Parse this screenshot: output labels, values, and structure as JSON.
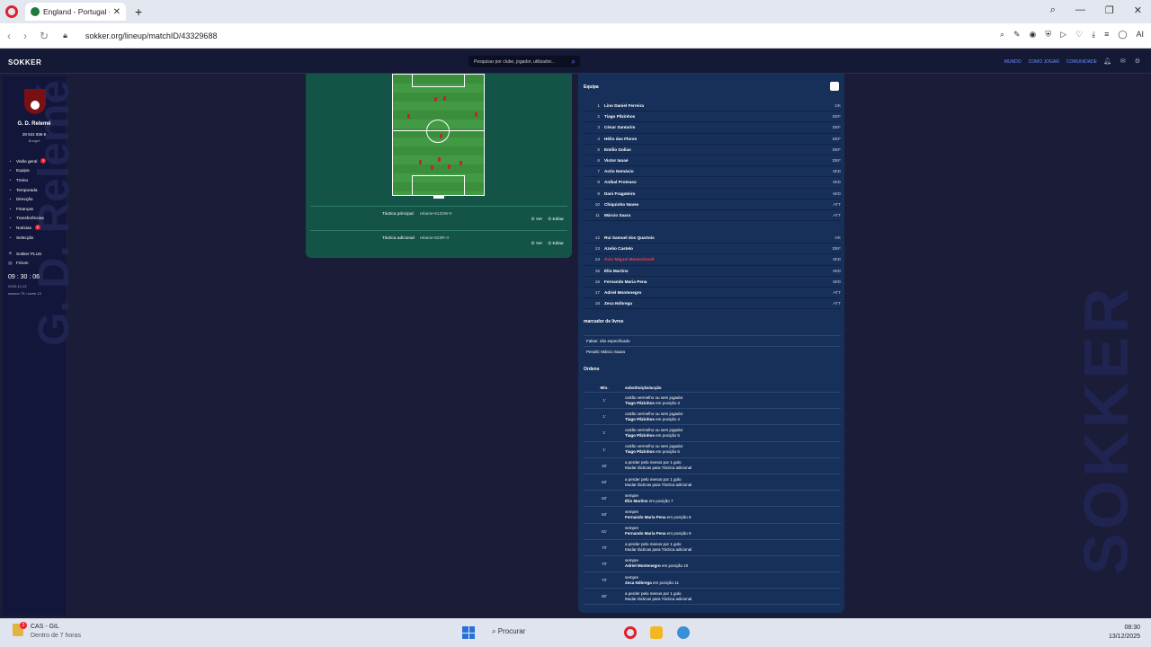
{
  "browser": {
    "tab_title": "England - Portugal - S",
    "url": "sokker.org/lineup/matchID/43329688",
    "ai_label": "AI"
  },
  "site": {
    "logo": "SOKKER",
    "search_placeholder": "Pesquisar por clube, jogador, utilizador...",
    "nav": [
      "MUNDO",
      "COMO JOGAR",
      "COMUNIDADE"
    ]
  },
  "sidebar": {
    "club": "G. D. Relemé",
    "budget_value": "28 531 836 €",
    "budget_label": "Budget",
    "menu": [
      {
        "label": "Visão geral",
        "badge": "5",
        "icon": "gauge-icon"
      },
      {
        "label": "Equipa",
        "badge": "",
        "icon": "team-icon"
      },
      {
        "label": "Treino",
        "badge": "",
        "icon": "training-icon"
      },
      {
        "label": "Temporada",
        "badge": "",
        "icon": "trophy-icon"
      },
      {
        "label": "Direcção",
        "badge": "",
        "icon": "office-icon"
      },
      {
        "label": "Finanças",
        "badge": "",
        "icon": "chart-icon"
      },
      {
        "label": "Transferências",
        "badge": "",
        "icon": "transfer-icon"
      },
      {
        "label": "Notícias",
        "badge": "8",
        "icon": "news-icon"
      },
      {
        "label": "Selecção",
        "badge": "",
        "icon": "flag-icon"
      }
    ],
    "menu2": [
      "Sokker PLUS",
      "Fórum"
    ],
    "clock": "09 : 30 : 06",
    "date": "2025-12-13",
    "season": "season 75 / week 13",
    "bg_text": "G. D. Relemé"
  },
  "tactics": [
    {
      "label": "Táctica principal",
      "value": "relame-5122W-II",
      "view": "Ver",
      "edit": "Editar"
    },
    {
      "label": "Táctica adicional",
      "value": "relame-523R-II",
      "view": "Ver",
      "edit": "Editar"
    }
  ],
  "team": {
    "title": "Equipa",
    "starters": [
      {
        "n": "1",
        "name": "Lino Daniel Ferreira",
        "pos": "GK"
      },
      {
        "n": "2",
        "name": "Tiago Pãzinhos",
        "pos": "DEF"
      },
      {
        "n": "3",
        "name": "César Santarim",
        "pos": "DEF"
      },
      {
        "n": "4",
        "name": "Hélio das Flores",
        "pos": "DEF"
      },
      {
        "n": "5",
        "name": "Emílio Golias",
        "pos": "DEF"
      },
      {
        "n": "6",
        "name": "Victor Ianaé",
        "pos": "DEF"
      },
      {
        "n": "7",
        "name": "Actio Nemácio",
        "pos": "MID"
      },
      {
        "n": "8",
        "name": "Aníbal Proteaso",
        "pos": "MID"
      },
      {
        "n": "9",
        "name": "Dani Fragateiro",
        "pos": "MID"
      },
      {
        "n": "10",
        "name": "Chiquinho Naves",
        "pos": "ATT"
      },
      {
        "n": "11",
        "name": "Márcio Saara",
        "pos": "ATT"
      }
    ],
    "bench": [
      {
        "n": "12",
        "name": "Rui Samuel dos Quartois",
        "pos": "GK",
        "red": false
      },
      {
        "n": "13",
        "name": "Azelio Castelo",
        "pos": "DEF",
        "red": false
      },
      {
        "n": "14",
        "name": "Ávio Miguel Mesentissell",
        "pos": "MID",
        "red": true
      },
      {
        "n": "15",
        "name": "Élio Martins",
        "pos": "MID",
        "red": false
      },
      {
        "n": "16",
        "name": "Fernando Maria Pena",
        "pos": "MID",
        "red": false
      },
      {
        "n": "17",
        "name": "Adriel Montenegro",
        "pos": "ATT",
        "red": false
      },
      {
        "n": "18",
        "name": "Zeca Nóbrega",
        "pos": "ATT",
        "red": false
      }
    ]
  },
  "set_pieces": {
    "title": "marcador de livres",
    "fouls": "Faltas: não especificado",
    "penalty": "Penalti: Márcio Saara"
  },
  "orders": {
    "title": "Ordens",
    "col_min": "Min.",
    "col_sub": "substituição/acção",
    "rows": [
      {
        "min": "1'",
        "l1": "cartão vermelho ou sem jogador",
        "name": "Tiago Pãzinhos",
        "l2": " em posição 3"
      },
      {
        "min": "1'",
        "l1": "cartão vermelho ou sem jogador",
        "name": "Tiago Pãzinhos",
        "l2": " em posição 4"
      },
      {
        "min": "1'",
        "l1": "cartão vermelho ou sem jogador",
        "name": "Tiago Pãzinhos",
        "l2": " em posição 5"
      },
      {
        "min": "1'",
        "l1": "cartão vermelho ou sem jogador",
        "name": "Tiago Pãzinhos",
        "l2": " em posição 6"
      },
      {
        "min": "45'",
        "l1": "a perder pelo menos por 1 golo",
        "name": "",
        "l2": "Mudar tácticas para Táctica adicional"
      },
      {
        "min": "60'",
        "l1": "a perder pelo menos por 1 golo",
        "name": "",
        "l2": "Mudar tácticas para Táctica adicional"
      },
      {
        "min": "60'",
        "l1": "sempre",
        "name": "Élio Martins",
        "l2": " em posição 7"
      },
      {
        "min": "60'",
        "l1": "sempre",
        "name": "Fernando Maria Pena",
        "l2": " em posição 8"
      },
      {
        "min": "61'",
        "l1": "sempre",
        "name": "Fernando Maria Pena",
        "l2": " em posição 9"
      },
      {
        "min": "70'",
        "l1": "a perder pelo menos por 1 golo",
        "name": "",
        "l2": "Mudar tácticas para Táctica adicional"
      },
      {
        "min": "70'",
        "l1": "sempre",
        "name": "Adriel Montenegro",
        "l2": " em posição 10"
      },
      {
        "min": "70'",
        "l1": "sempre",
        "name": "Zeca Nóbrega",
        "l2": " em posição 11"
      },
      {
        "min": "80'",
        "l1": "a perder pelo menos por 1 golo",
        "name": "",
        "l2": "Mudar tácticas para Táctica adicional"
      }
    ]
  },
  "right_bg_text": "SOKKER",
  "taskbar": {
    "weather_badge": "2",
    "weather_title": "CAS - GIL",
    "weather_sub": "Dentro de 7 horas",
    "search": "Procurar",
    "time": "08:30",
    "date": "13/12/2025"
  },
  "colors": {
    "accent": "#6a8bff",
    "red": "#ff3b4a",
    "pitch": "#3a8e3c",
    "panel": "#16305a"
  }
}
